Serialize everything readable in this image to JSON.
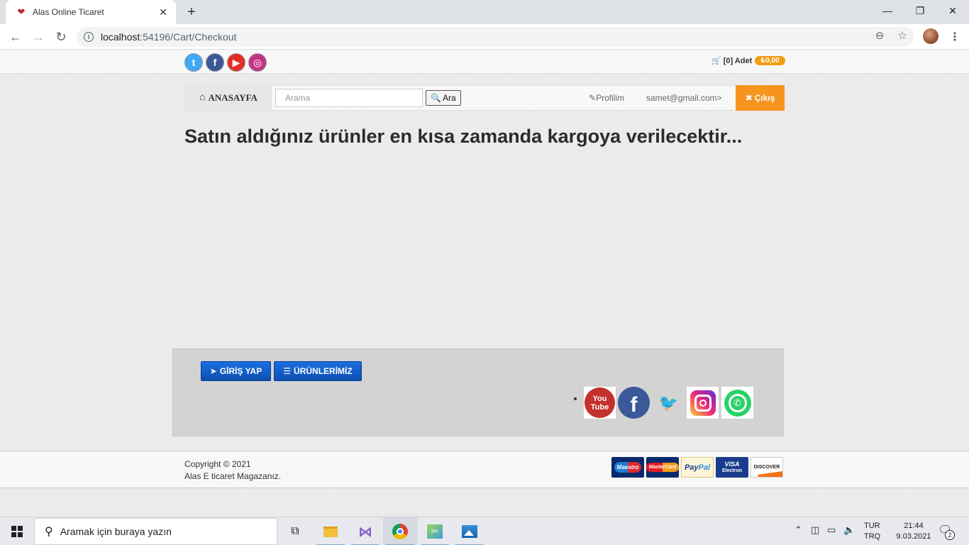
{
  "browser": {
    "tab_title": "Alas Online Ticaret",
    "tab_close": "✕",
    "new_tab": "+",
    "url_host": "localhost",
    "url_path": ":54196/Cart/Checkout",
    "window_controls": {
      "minimize": "—",
      "maximize": "❐",
      "close": "✕"
    }
  },
  "topbar": {
    "social": [
      {
        "name": "twitter",
        "glyph": "t",
        "color": "#3fa9f5"
      },
      {
        "name": "facebook",
        "glyph": "f",
        "color": "#3b5998"
      },
      {
        "name": "youtube",
        "glyph": "▶",
        "color": "#e52d27"
      },
      {
        "name": "instagram",
        "glyph": "◎",
        "color": "#c13584"
      }
    ],
    "cart_label": "[0] Adet",
    "cart_total": "₺0,00"
  },
  "navbar": {
    "home_label": "ANASAYFA",
    "search_placeholder": "Arama",
    "search_button": "Ara",
    "profile_label": "Profilim",
    "email_label": "samet@gmail.com>",
    "logout_label": "Çıkış"
  },
  "main": {
    "heading": "Satın aldığınız ürünler en kısa zamanda kargoya verilecektir..."
  },
  "footer": {
    "login_button": "GİRİŞ YAP",
    "products_button": "ÜRÜNLERİMİZ",
    "youtube_top": "You",
    "youtube_bottom": "Tube",
    "copyright_line1": "Copyright © 2021",
    "copyright_line2": "Alas E ticaret Magazanız.",
    "payments": {
      "maestro": "Maestro",
      "mastercard": "MasterCard",
      "paypal_pay": "Pay",
      "paypal_pal": "Pal",
      "visa": "VISA",
      "visa_sub": "Electron",
      "discover": "DISCOVER"
    }
  },
  "taskbar": {
    "search_placeholder": "Aramak için buraya yazın",
    "lang_top": "TUR",
    "lang_bottom": "TRQ",
    "time": "21:44",
    "date": "9.03.2021",
    "notification_count": "2"
  }
}
